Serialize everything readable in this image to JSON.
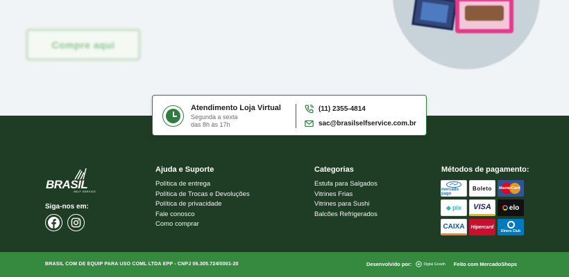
{
  "hero": {
    "cta_label": "Compre aqui"
  },
  "service": {
    "title": "Atendimento Loja Virtual",
    "hours_line1": "Segunda a sexta",
    "hours_line2": "das 8h às 17h",
    "phone": "(11) 2355-4814",
    "email": "sac@brasilselfservice.com.br"
  },
  "brand": {
    "logo_text": "BRASIL",
    "logo_sub": "SELF SERVICE",
    "follow_label": "Siga-nos em:"
  },
  "support": {
    "title": "Ajuda e Suporte",
    "links": [
      "Política de entrega",
      "Política de Trocas e Devoluções",
      "Política de privacidade",
      "Fale conosco",
      "Como comprar"
    ]
  },
  "categories": {
    "title": "Categorias",
    "links": [
      "Estufa para Salgados",
      "Vitrines Frias",
      "Vitrines para Sushi",
      "Balcões Refrigerados"
    ]
  },
  "payments": {
    "title": "Métodos de pagamento:",
    "methods": [
      {
        "name": "Mercado Pago",
        "label": "mercado pago"
      },
      {
        "name": "Boleto",
        "label": "Boleto"
      },
      {
        "name": "MasterCard",
        "label": "MasterCard"
      },
      {
        "name": "Pix",
        "label": "pix"
      },
      {
        "name": "Visa",
        "label": "VISA"
      },
      {
        "name": "Elo",
        "label": "elo"
      },
      {
        "name": "Caixa",
        "label": "CAIXA"
      },
      {
        "name": "Hipercard",
        "label": "Hipercard"
      },
      {
        "name": "Diners Club",
        "label": "Diners Club"
      }
    ]
  },
  "bottom": {
    "legal": "BRASIL COM DE EQUIP PARA USO COML LTDA EPP - CNPJ 06.305.724/0001-20",
    "developed_by": "Desenvolvido por:",
    "developer": "Digital Growth",
    "made_with": "Feito com MercadoShops"
  },
  "colors": {
    "footer_dark": "#1f3d25",
    "bottom_bar": "#358a3f",
    "accent_green": "#2f7d3e"
  }
}
